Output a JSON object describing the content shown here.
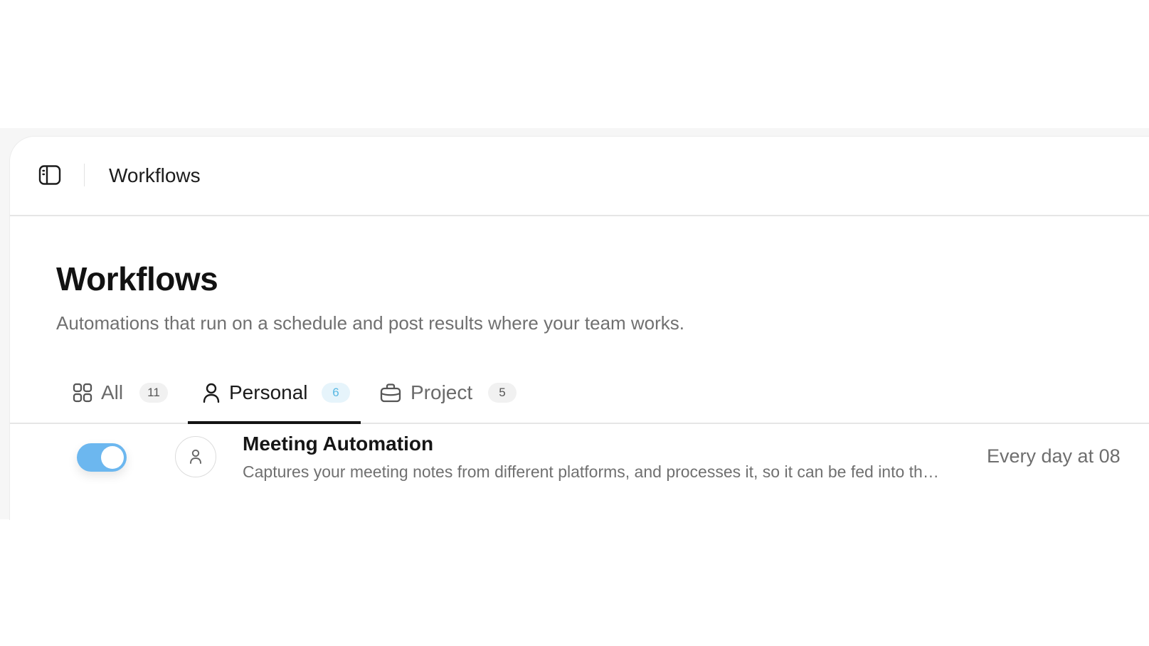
{
  "header": {
    "title": "Workflows",
    "sidebar_toggle_icon": "sidebar-toggle-icon"
  },
  "page": {
    "title": "Workflows",
    "subtitle": "Automations that run on a schedule and post results where your team works."
  },
  "tabs": [
    {
      "label": "All",
      "count": "11",
      "icon": "grid-icon",
      "active": false
    },
    {
      "label": "Personal",
      "count": "6",
      "icon": "user-icon",
      "active": true
    },
    {
      "label": "Project",
      "count": "5",
      "icon": "briefcase-icon",
      "active": false
    }
  ],
  "workflows": [
    {
      "enabled": true,
      "owner_icon": "user-icon",
      "title": "Meeting Automation",
      "description": "Captures your meeting notes from different platforms, and processes it, so it can be fed into th…",
      "schedule": "Every day at 08"
    }
  ],
  "colors": {
    "toggle_on": "#6cb7ef",
    "active_count_bg": "#e6f4fb",
    "active_count_text": "#59b8e3",
    "active_underline": "#141414"
  }
}
